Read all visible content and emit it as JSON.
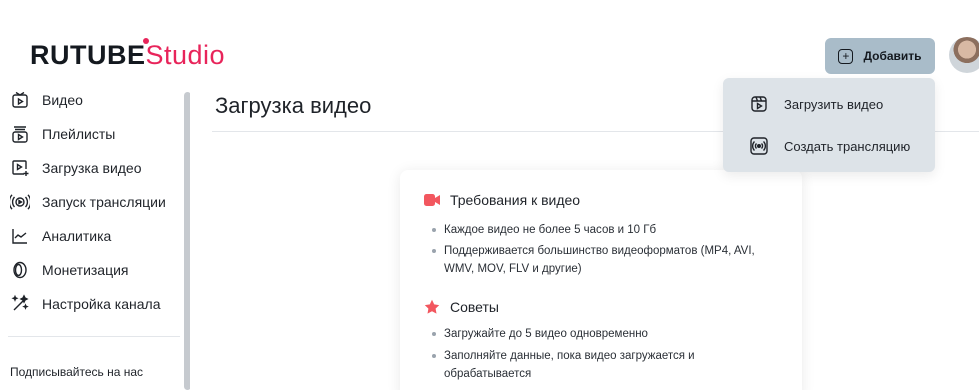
{
  "header": {
    "logo_brand": "RUTUBE",
    "logo_studio": "Studio",
    "add_button_label": "Добавить",
    "add_button_icon": "plus-square-icon"
  },
  "sidebar": {
    "items": [
      {
        "label": "Видео",
        "icon": "video-icon"
      },
      {
        "label": "Плейлисты",
        "icon": "playlist-icon"
      },
      {
        "label": "Загрузка видео",
        "icon": "upload-video-icon"
      },
      {
        "label": "Запуск трансляции",
        "icon": "broadcast-icon"
      },
      {
        "label": "Аналитика",
        "icon": "analytics-icon"
      },
      {
        "label": "Монетизация",
        "icon": "monetization-icon"
      },
      {
        "label": "Настройка канала",
        "icon": "channel-settings-icon"
      }
    ],
    "follow_label": "Подписывайтесь на нас"
  },
  "main": {
    "title": "Загрузка видео",
    "requirements": {
      "title": "Требования к видео",
      "icon": "camera-icon",
      "bullets": [
        "Каждое видео не более 5 часов и 10 Гб",
        "Поддерживается большинство видеоформатов (MP4, AVI, WMV, MOV, FLV и другие)"
      ]
    },
    "tips": {
      "title": "Советы",
      "icon": "star-icon",
      "bullets": [
        "Загружайте до 5 видео одновременно",
        "Заполняйте данные, пока видео загружается и обрабатывается"
      ]
    }
  },
  "dropdown": {
    "items": [
      {
        "label": "Загрузить видео",
        "icon": "upload-video-icon"
      },
      {
        "label": "Создать трансляцию",
        "icon": "broadcast-icon"
      }
    ]
  },
  "colors": {
    "accent": "#e8245a",
    "button_bg": "#a9bcc9",
    "dropdown_bg": "#dde3e8",
    "icon_red": "#f2575f"
  }
}
